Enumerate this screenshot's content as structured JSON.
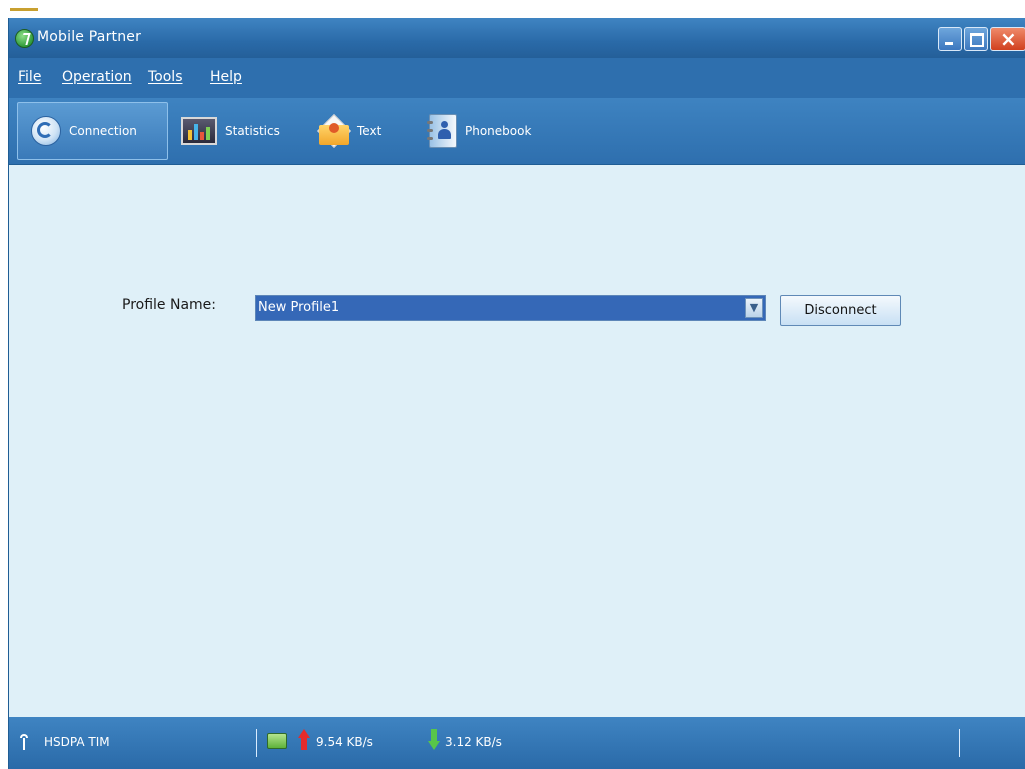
{
  "window": {
    "title": "Mobile Partner"
  },
  "menu": [
    {
      "label": "File"
    },
    {
      "label": "Operation"
    },
    {
      "label": "Tools"
    },
    {
      "label": "Help"
    }
  ],
  "toolbar": [
    {
      "label": "Connection",
      "icon": "connection-icon",
      "active": true
    },
    {
      "label": "Statistics",
      "icon": "statistics-icon",
      "active": false
    },
    {
      "label": "Text",
      "icon": "envelope-icon",
      "active": false
    },
    {
      "label": "Phonebook",
      "icon": "phonebook-icon",
      "active": false
    }
  ],
  "profile": {
    "label": "Profile Name:",
    "value": "New Profile1",
    "button": "Disconnect"
  },
  "status": {
    "network": "HSDPA TIM",
    "upload": "9.54 KB/s",
    "download": "3.12 KB/s"
  },
  "colors": {
    "titlebar": "#2a6aa8",
    "menubar": "#2e6fae",
    "content_bg": "#dff0f8",
    "select_bg": "#3568b7",
    "close_button": "#d1401f"
  }
}
